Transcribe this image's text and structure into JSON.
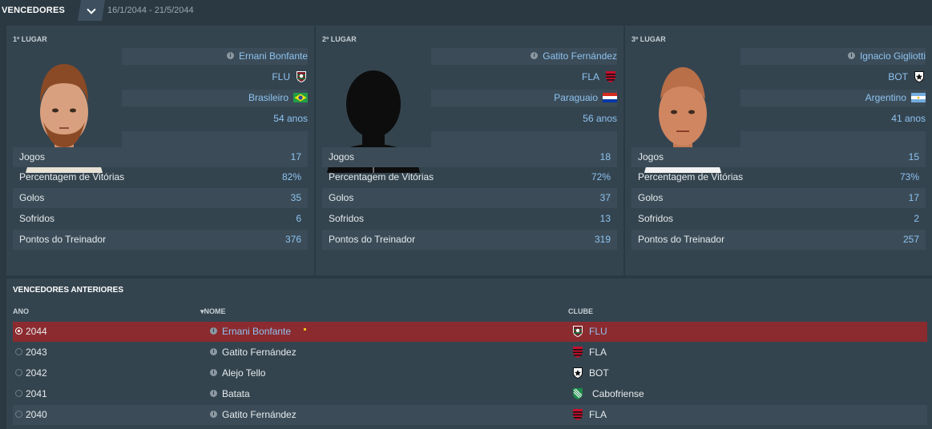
{
  "header": {
    "title": "VENCEDORES",
    "date_range": "16/1/2044 - 21/5/2044"
  },
  "podium": [
    {
      "place": "1º LUGAR",
      "name": "Ernani Bonfante",
      "club": "FLU",
      "club_icon": "fluminense-crest-icon",
      "nationality": "Brasileiro",
      "flag_icon": "brazil-flag-icon",
      "age": "54 anos",
      "stats": [
        {
          "label": "Jogos",
          "value": "17"
        },
        {
          "label": "Percentagem de Vitórias",
          "value": "82%"
        },
        {
          "label": "Golos",
          "value": "35"
        },
        {
          "label": "Sofridos",
          "value": "6"
        },
        {
          "label": "Pontos do Treinador",
          "value": "376"
        }
      ]
    },
    {
      "place": "2º LUGAR",
      "name": "Gatito Fernández",
      "club": "FLA",
      "club_icon": "flamengo-crest-icon",
      "nationality": "Paraguaio",
      "flag_icon": "paraguay-flag-icon",
      "age": "56 anos",
      "stats": [
        {
          "label": "Jogos",
          "value": "18"
        },
        {
          "label": "Percentagem de Vitórias",
          "value": "72%"
        },
        {
          "label": "Golos",
          "value": "37"
        },
        {
          "label": "Sofridos",
          "value": "13"
        },
        {
          "label": "Pontos do Treinador",
          "value": "319"
        }
      ]
    },
    {
      "place": "3º LUGAR",
      "name": "Ignacio Gigliotti",
      "club": "BOT",
      "club_icon": "botafogo-crest-icon",
      "nationality": "Argentino",
      "flag_icon": "argentina-flag-icon",
      "age": "41 anos",
      "stats": [
        {
          "label": "Jogos",
          "value": "15"
        },
        {
          "label": "Percentagem de Vitórias",
          "value": "73%"
        },
        {
          "label": "Golos",
          "value": "17"
        },
        {
          "label": "Sofridos",
          "value": "2"
        },
        {
          "label": "Pontos do Treinador",
          "value": "257"
        }
      ]
    }
  ],
  "history": {
    "title": "VENCEDORES ANTERIORES",
    "columns": {
      "year": "ANO",
      "name": "NOME",
      "club": "CLUBE"
    },
    "rows": [
      {
        "year": "2044",
        "name": "Ernani Bonfante",
        "club": "FLU"
      },
      {
        "year": "2043",
        "name": "Gatito Fernández",
        "club": "FLA"
      },
      {
        "year": "2042",
        "name": "Alejo Tello",
        "club": "BOT"
      },
      {
        "year": "2041",
        "name": "Batata",
        "club": "Cabofriense"
      },
      {
        "year": "2040",
        "name": "Gatito Fernández",
        "club": "FLA"
      }
    ]
  },
  "colors": {
    "background": "#2b3942",
    "panel": "#34444f",
    "selected_row": "#8b2b2f",
    "link": "#8ec2f0"
  }
}
